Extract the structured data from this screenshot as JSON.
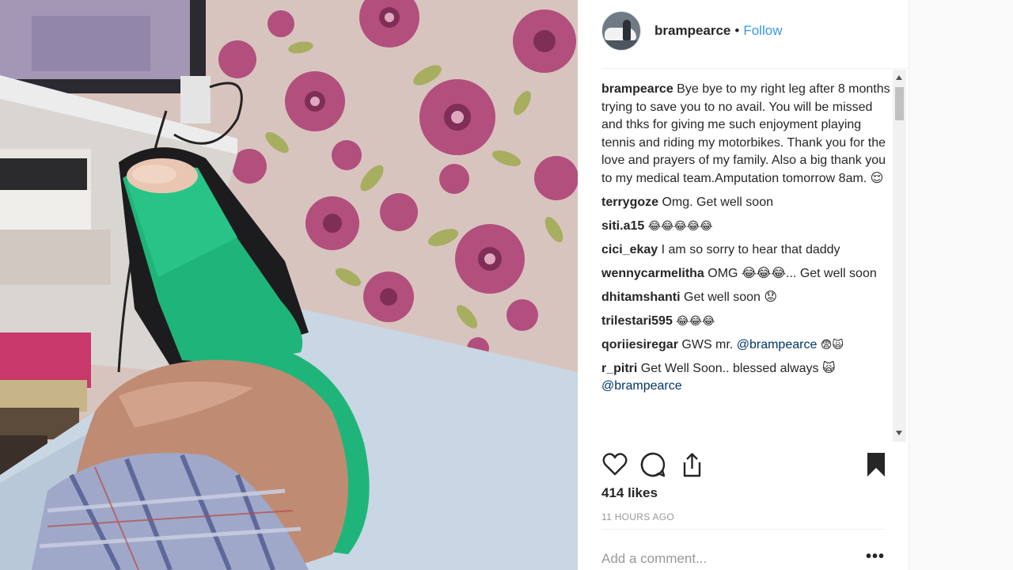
{
  "post": {
    "username": "brampearce",
    "separator": "•",
    "follow_label": "Follow"
  },
  "comments": [
    {
      "user": "brampearce",
      "text": "Bye bye to my right leg after 8 months trying to save you to no avail. You will be missed and thks for giving me such enjoyment playing tennis and riding my motorbikes. Thank you for the love and prayers of my family. Also a big thank you to my medical team.Amputation tomorrow 8am. 😌"
    },
    {
      "user": "terrygoze",
      "text": "Omg. Get well soon"
    },
    {
      "user": "siti.a15",
      "text": "😂😂😂😂😂"
    },
    {
      "user": "cici_ekay",
      "text": "I am so sorry to hear that daddy"
    },
    {
      "user": "wennycarmelitha",
      "text": "OMG 😂😂😂... Get well soon"
    },
    {
      "user": "dhitamshanti",
      "text": "Get well soon 😟"
    },
    {
      "user": "trilestari595",
      "text": "😂😂😂"
    },
    {
      "user": "qoriiesiregar",
      "text": "GWS mr.",
      "mention": "@brampearce",
      "suffix": "😨🙀"
    },
    {
      "user": "r_pitri",
      "text": "Get Well Soon.. blessed always 🙀",
      "mention": "@brampearce"
    }
  ],
  "likes": "414 likes",
  "time_ago": "11 HOURS AGO",
  "add_comment_placeholder": "Add a comment...",
  "more_label": "•••",
  "icons": {
    "like": "heart-icon",
    "comment": "comment-bubble-icon",
    "share": "share-icon",
    "save": "bookmark-icon"
  },
  "colors": {
    "link": "#3897f0",
    "text": "#262626",
    "muted": "#999999",
    "cast": "#1fb57a"
  }
}
